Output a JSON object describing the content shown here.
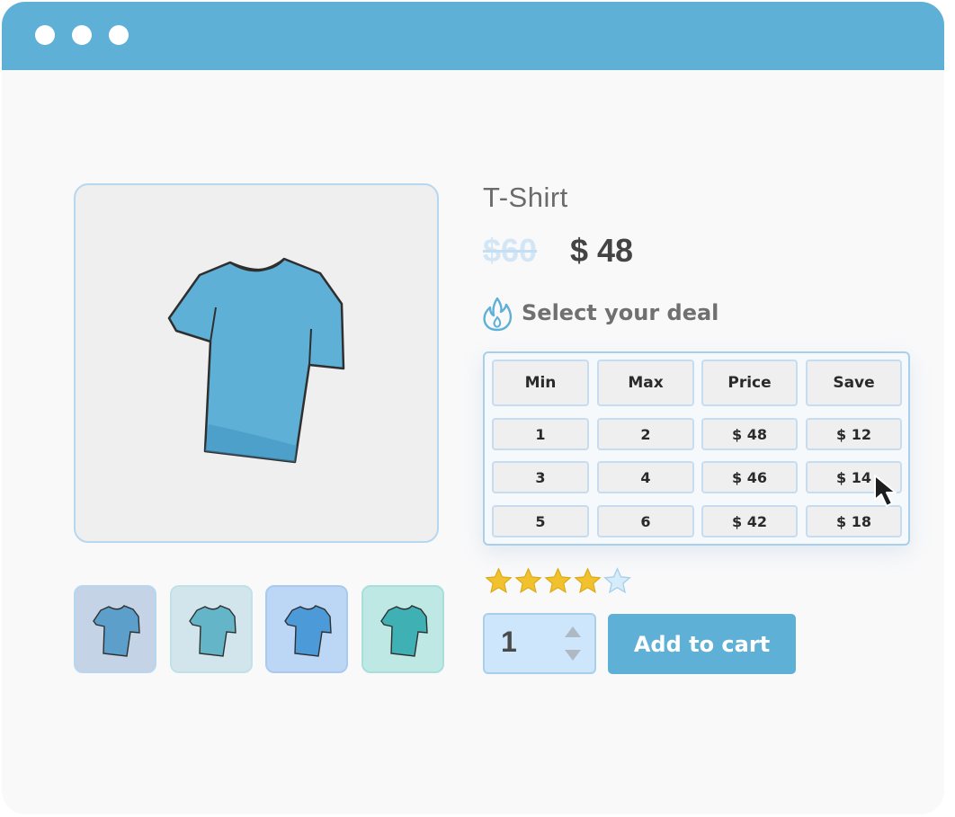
{
  "window": {
    "titlebar_color": "#5eb0d7",
    "window_controls": [
      "dot",
      "dot",
      "dot"
    ]
  },
  "product": {
    "title": "T-Shirt",
    "old_price": "$60",
    "new_price": "$ 48",
    "image_icon": "tshirt-icon",
    "shirt_color": "#5eb0d7"
  },
  "thumbnails": [
    {
      "icon": "tshirt-icon",
      "shirt_color": "#5b9fca",
      "background": "#c4d3e6"
    },
    {
      "icon": "tshirt-icon",
      "shirt_color": "#63b5c7",
      "background": "#d2e5ec"
    },
    {
      "icon": "tshirt-icon",
      "shirt_color": "#4d9ad9",
      "background": "#bcd7f6"
    },
    {
      "icon": "tshirt-icon",
      "shirt_color": "#3fb0b4",
      "background": "#bde8e4"
    }
  ],
  "deal": {
    "icon": "flame-icon",
    "label": "Select your deal",
    "headers": [
      "Min",
      "Max",
      "Price",
      "Save"
    ],
    "rows": [
      [
        "1",
        "2",
        "$ 48",
        "$ 12"
      ],
      [
        "3",
        "4",
        "$ 46",
        "$ 14"
      ],
      [
        "5",
        "6",
        "$ 42",
        "$ 18"
      ]
    ]
  },
  "rating": {
    "value": 4,
    "max": 5,
    "filled_color": "#f2c12e"
  },
  "cart": {
    "quantity": "1",
    "button_label": "Add to cart",
    "accent": "#5eb0d7"
  }
}
